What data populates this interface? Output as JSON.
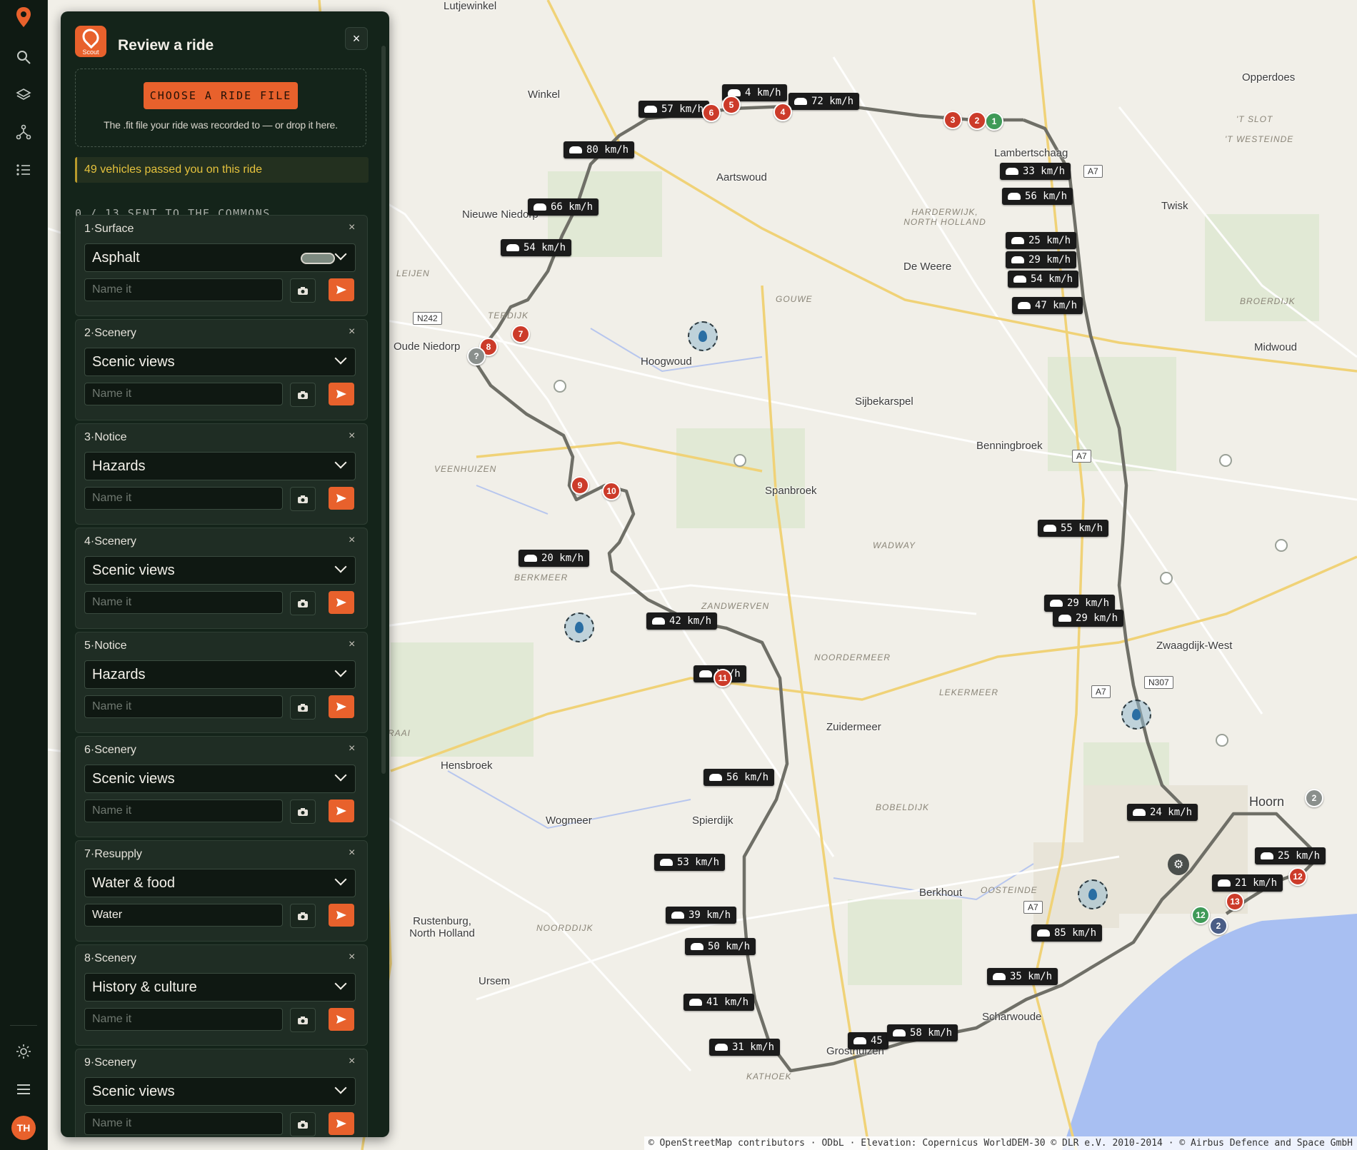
{
  "rail": {
    "items": [
      "location-pin-icon",
      "search-icon",
      "layers-icon",
      "route-icon",
      "list-icon"
    ],
    "bottom": [
      "sun-icon",
      "menu-icon"
    ],
    "avatar_initials": "TH"
  },
  "panel": {
    "title": "Review a ride",
    "logo_text": "Scout",
    "close_label": "×",
    "choose_file_label": "CHOOSE A RIDE FILE",
    "dropzone_hint": "The .fit file your ride was recorded to — or drop it here.",
    "vehicles_banner": "49 vehicles passed you on this ride",
    "commons_count": "0 / 13 SENT TO THE COMMONS",
    "name_placeholder": "Name it",
    "cards": [
      {
        "header": "1·Surface",
        "value": "Asphalt",
        "name": ""
      },
      {
        "header": "2·Scenery",
        "value": "Scenic views",
        "name": ""
      },
      {
        "header": "3·Notice",
        "value": "Hazards",
        "name": ""
      },
      {
        "header": "4·Scenery",
        "value": "Scenic views",
        "name": ""
      },
      {
        "header": "5·Notice",
        "value": "Hazards",
        "name": ""
      },
      {
        "header": "6·Scenery",
        "value": "Scenic views",
        "name": ""
      },
      {
        "header": "7·Resupply",
        "value": "Water & food",
        "name": "Water"
      },
      {
        "header": "8·Scenery",
        "value": "History & culture",
        "name": ""
      },
      {
        "header": "9·Scenery",
        "value": "Scenic views",
        "name": ""
      }
    ]
  },
  "map": {
    "places": [
      "Lutjewinkel",
      "Winkel",
      "Aartswoud",
      "Nieuwe Niedorp",
      "Oude Niedorp",
      "Hoogwoud",
      "De Weere",
      "Lambertschaag",
      "Twisk",
      "Opperdoes",
      "Midwoud",
      "Sijbekarspel",
      "Benningbroek",
      "Spanbroek",
      "Zwaagdijk-West",
      "Zuidermeer",
      "Hensbroek",
      "Wogmeer",
      "Spierdijk",
      "Hoorn",
      "Berkhout",
      "Rustenburg, North Holland",
      "Ursem",
      "Scharwoude",
      "Grosthuizen"
    ],
    "areas": [
      "HARDERWIJK, NORTH HOLLAND",
      "GOUWE",
      "BROERDIJK",
      "'T SLOT",
      "'T WESTEINDE",
      "VEENHUIZEN",
      "BERKMEER",
      "WADWAY",
      "ZANDWERVEN",
      "NOORDERMEER",
      "LEKERMEER",
      "BOBELDIJK",
      "OOSTEINDE",
      "NOORDDIJK",
      "KATHOEK",
      "TERDIJK",
      "LEIJEN",
      "RAAI"
    ],
    "shields": [
      "A7",
      "A7",
      "A7",
      "A7",
      "N242",
      "N307"
    ],
    "speeds": [
      "57 km/h",
      "4 km/h",
      "72 km/h",
      "80 km/h",
      "66 km/h",
      "54 km/h",
      "33 km/h",
      "56 km/h",
      "25 km/h",
      "29 km/h",
      "54 km/h",
      "47 km/h",
      "55 km/h",
      "29 km/h",
      "29 km/h",
      "20 km/h",
      "42 km/h",
      "km/h",
      "56 km/h",
      "53 km/h",
      "39 km/h",
      "50 km/h",
      "41 km/h",
      "31 km/h",
      "45",
      "58 km/h",
      "35 km/h",
      "85 km/h",
      "24 km/h",
      "25 km/h",
      "21 km/h"
    ],
    "pins": [
      "1",
      "2",
      "3",
      "4",
      "5",
      "6",
      "7",
      "8",
      "?",
      "9",
      "10",
      "11",
      "12",
      "13",
      "2",
      "12",
      "2"
    ],
    "attribution": "© OpenStreetMap contributors · ODbL · Elevation: Copernicus WorldDEM-30 © DLR e.V. 2010-2014 · © Airbus Defence and Space GmbH"
  },
  "colors": {
    "accent": "#e8612c",
    "panel_bg": "#14241a",
    "banner_text": "#e5c23d",
    "route": "#6f6f67"
  }
}
